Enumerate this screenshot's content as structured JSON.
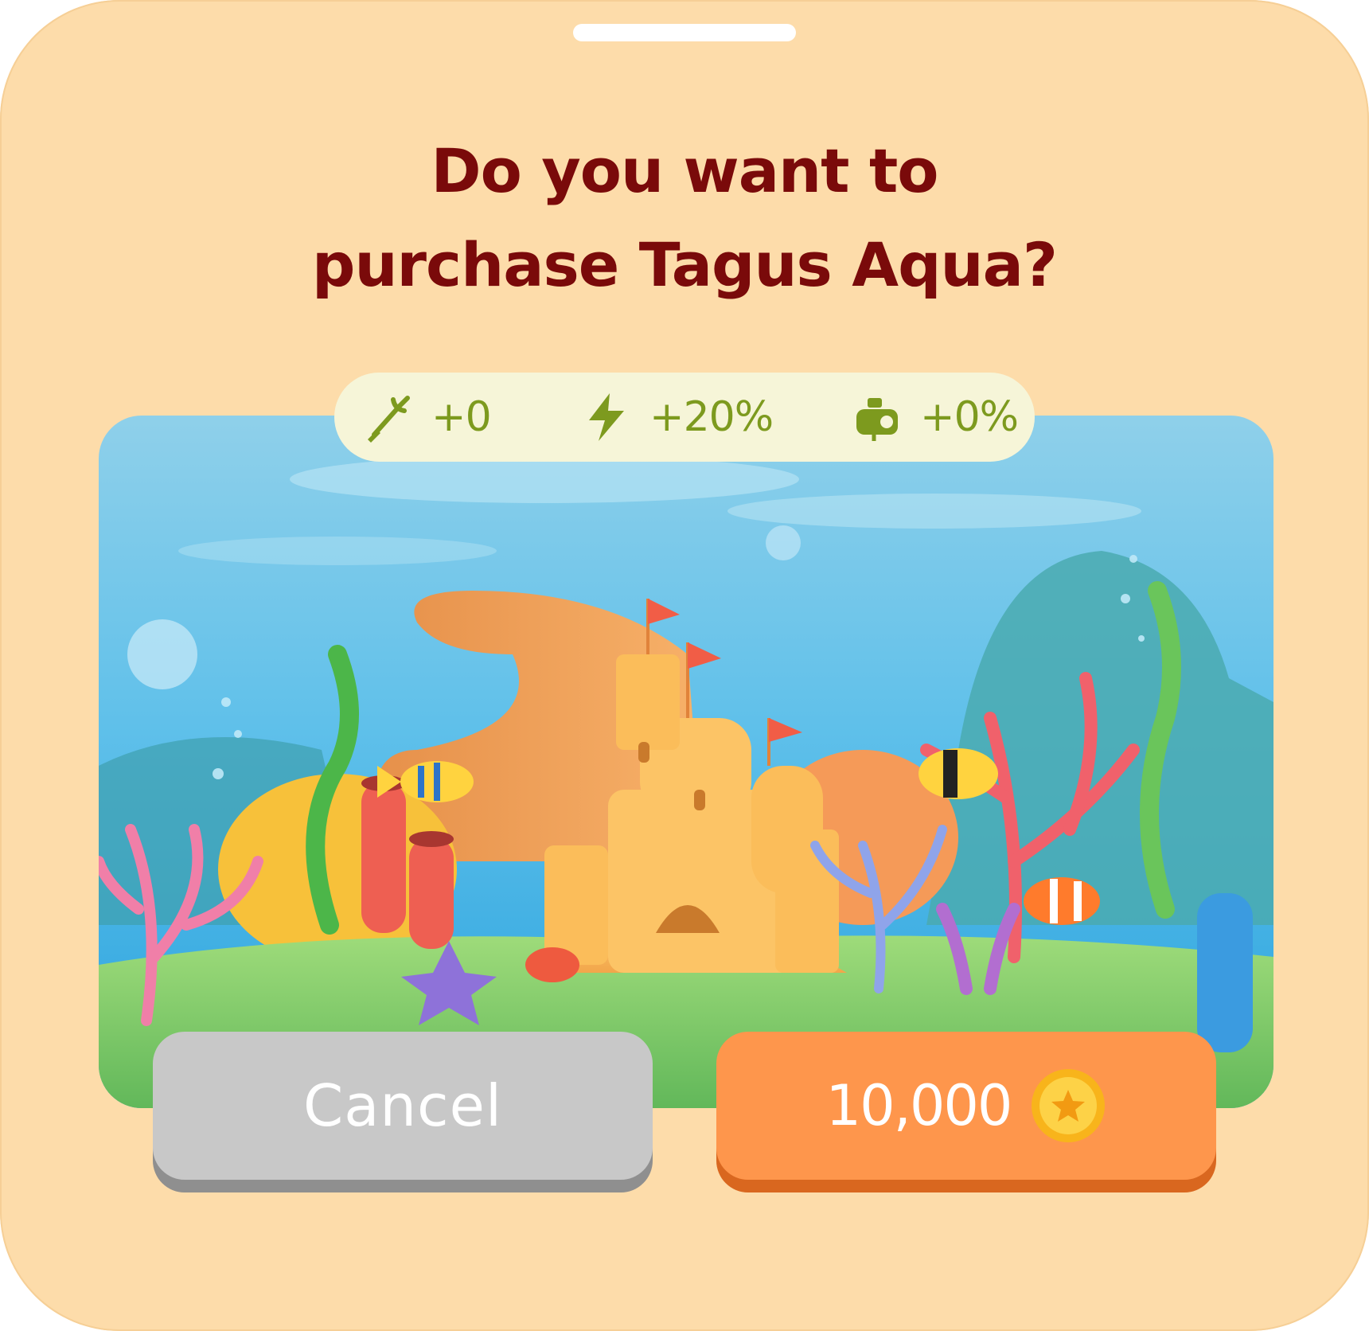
{
  "dialog": {
    "title_line1": "Do you want to",
    "title_line2": "purchase Tagus Aqua?"
  },
  "stats": [
    {
      "icon": "trident-icon",
      "value": "+0"
    },
    {
      "icon": "lightning-icon",
      "value": "+20%"
    },
    {
      "icon": "pump-icon",
      "value": "+0%"
    }
  ],
  "buttons": {
    "cancel_label": "Cancel",
    "buy_price": "10,000",
    "buy_icon": "coin-star-icon"
  },
  "colors": {
    "background": "#fddcaa",
    "title": "#7a0a0a",
    "stat_text": "#7d9a1e",
    "stat_pill": "#f6f5d8",
    "cancel": "#c8c8c8",
    "buy": "#fe964c"
  }
}
